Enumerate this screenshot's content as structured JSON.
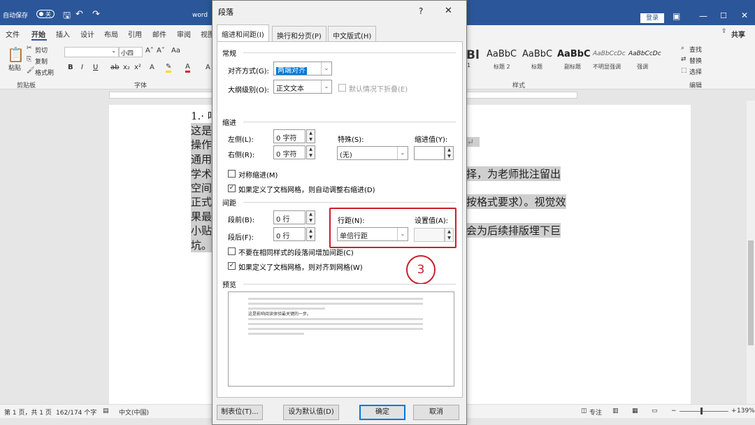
{
  "titlebar": {
    "autosave_label": "自动保存",
    "autosave_state": "关",
    "doc_title": "word",
    "login_label": "登录"
  },
  "ribbon_tabs": [
    "文件",
    "开始",
    "插入",
    "设计",
    "布局",
    "引用",
    "邮件",
    "审阅",
    "视图"
  ],
  "share_label": "共享",
  "ribbon": {
    "paste": "粘贴",
    "cut": "剪切",
    "copy": "复制",
    "format_painter": "格式刷",
    "clipboard_group": "剪贴板",
    "font_size": "小四",
    "font_group": "字体",
    "styles": [
      {
        "sample": "AaBbC",
        "label": "标题 2"
      },
      {
        "sample": "AaBbC",
        "label": "标题"
      },
      {
        "sample": "AaBbC",
        "label": "副标题"
      },
      {
        "sample": "AaBbCcDc",
        "label": "不明显强调"
      },
      {
        "sample": "AaBbCcDc",
        "label": "强调"
      }
    ],
    "style_partial": "Bl",
    "style_partial_label": "1",
    "styles_group": "样式",
    "find": "查找",
    "replace": "替换",
    "select": "选择",
    "edit_group": "编辑"
  },
  "document": {
    "lines": [
      "1.· 吗",
      "这是",
      "操作",
      "通用",
      "学术",
      "空间",
      "正式",
      "果最",
      "小贴",
      "坑。"
    ],
    "right_fragments": [
      "选择，为老师批注留出",
      "格按格式要求）。视觉效",
      "部会为后续排版埋下巨"
    ]
  },
  "dialog": {
    "title": "段落",
    "help": "?",
    "close": "✕",
    "tabs": [
      "缩进和间距(I)",
      "换行和分页(P)",
      "中文版式(H)"
    ],
    "general": {
      "section": "常规",
      "alignment_label": "对齐方式(G):",
      "alignment_value": "两端对齐",
      "outline_label": "大纲级别(O):",
      "outline_value": "正文文本",
      "collapsed_label": "默认情况下折叠(E)"
    },
    "indent": {
      "section": "缩进",
      "left_label": "左侧(L):",
      "left_value": "0 字符",
      "right_label": "右侧(R):",
      "right_value": "0 字符",
      "special_label": "特殊(S):",
      "special_value": "(无)",
      "by_label": "缩进值(Y):",
      "mirror_label": "对称缩进(M)",
      "auto_adjust_label": "如果定义了文档网格，则自动调整右缩进(D)"
    },
    "spacing": {
      "section": "间距",
      "before_label": "段前(B):",
      "before_value": "0 行",
      "after_label": "段后(F):",
      "after_value": "0 行",
      "line_spacing_label": "行距(N):",
      "line_spacing_value": "单倍行距",
      "at_label": "设置值(A):",
      "no_space_same_style": "不要在相同样式的段落间增加间距(C)",
      "snap_to_grid": "如果定义了文档网格，则对齐到网格(W)"
    },
    "preview_section": "预览",
    "preview_sample": "这是影响阅读体验最关键的一步。",
    "buttons": {
      "tabs": "制表位(T)...",
      "set_default": "设为默认值(D)",
      "ok": "确定",
      "cancel": "取消"
    },
    "annotation_number": "3"
  },
  "statusbar": {
    "page": "第 1 页，共 1 页",
    "words": "162/174 个字",
    "language": "中文(中国)",
    "focus": "专注",
    "zoom": "139%"
  },
  "colors": {
    "titlebar": "#2b579a",
    "highlight": "#cfcfcf",
    "annotation_red": "#c8202a",
    "selection_blue": "#0078d7"
  }
}
